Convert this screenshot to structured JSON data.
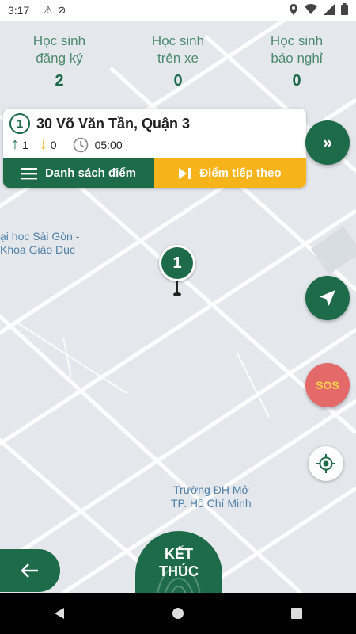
{
  "status_bar": {
    "time": "3:17",
    "icons": [
      "warning-icon",
      "sync-icon",
      "location-icon",
      "wifi-icon",
      "signal-icon",
      "battery-icon"
    ]
  },
  "stats": [
    {
      "label_line1": "Học sinh",
      "label_line2": "đăng ký",
      "value": "2"
    },
    {
      "label_line1": "Học sinh",
      "label_line2": "trên xe",
      "value": "0"
    },
    {
      "label_line1": "Học sinh",
      "label_line2": "báo nghỉ",
      "value": "0"
    }
  ],
  "stop_card": {
    "index": "1",
    "address": "30 Võ Văn Tần, Quận 3",
    "pickup_count": "1",
    "dropoff_count": "0",
    "time": "05:00",
    "list_button": "Danh sách điểm",
    "next_button": "Điểm tiếp theo"
  },
  "map": {
    "pin_label": "1",
    "label_top_line1": "ại học Sài Gòn -",
    "label_top_line2": "Khoa Giáo Dục",
    "label_bottom_line1": "Trường ĐH Mở",
    "label_bottom_line2": "TP. Hồ Chí Minh"
  },
  "sos_label": "SOS",
  "end_button": {
    "line1": "KẾT",
    "line2": "THÚC"
  },
  "colors": {
    "primary": "#1e6b4a",
    "accent": "#f6b41a",
    "sos": "#e46a6a"
  }
}
